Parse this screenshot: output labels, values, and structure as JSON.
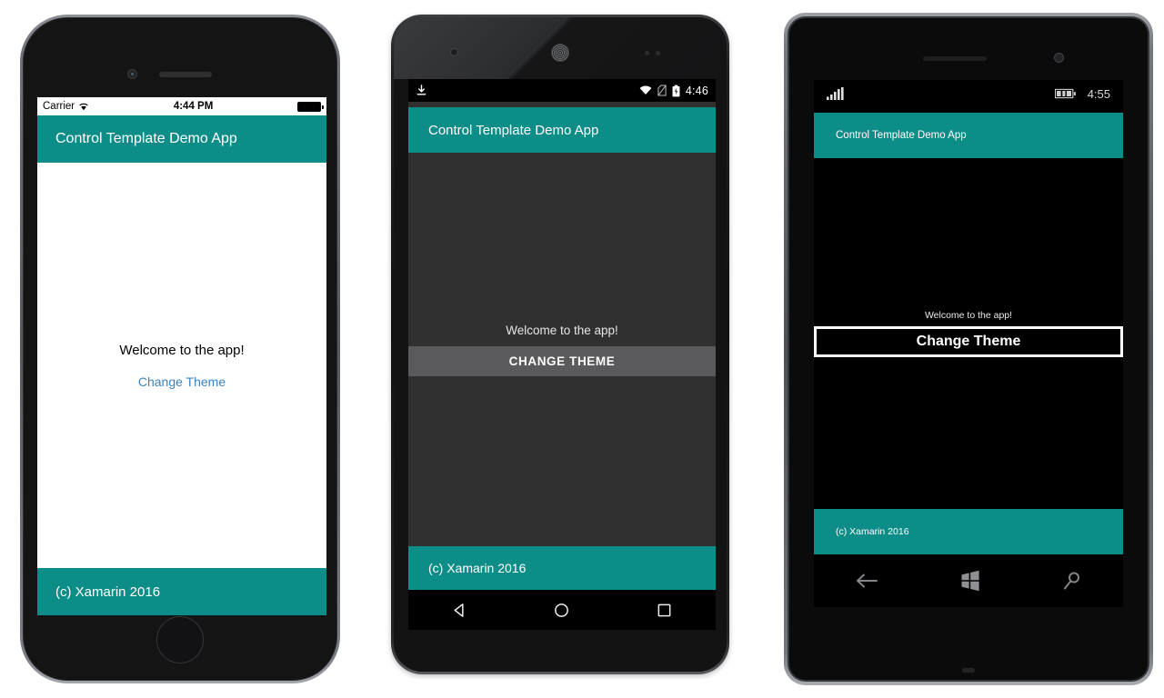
{
  "app": {
    "header_title": "Control Template Demo App",
    "welcome_text": "Welcome to the app!",
    "change_theme_label_ios": "Change Theme",
    "change_theme_label_android": "CHANGE THEME",
    "change_theme_label_windows": "Change Theme",
    "footer_text": "(c) Xamarin 2016"
  },
  "colors": {
    "accent_teal": "#0D8D88",
    "ios_link_blue": "#3B82C4",
    "android_page_bg": "#303030",
    "android_button_bg": "#5A5A5C",
    "windows_page_bg": "#000000",
    "ios_page_bg": "#FFFFFF"
  },
  "devices": [
    {
      "name": "iPhone",
      "platform": "ios",
      "status_bar": {
        "carrier": "Carrier",
        "wifi_icon": "wifi-icon",
        "time": "4:44 PM",
        "battery_icon": "battery-full-icon"
      }
    },
    {
      "name": "Android",
      "platform": "android",
      "status_bar": {
        "download_icon": "download-icon",
        "wifi_icon": "wifi-icon",
        "sim_icon": "no-sim-icon",
        "battery_icon": "battery-charging-icon",
        "time": "4:46"
      },
      "nav_bar": {
        "back": "back-triangle-icon",
        "home": "home-circle-icon",
        "recents": "recents-square-icon"
      }
    },
    {
      "name": "Windows Phone",
      "platform": "windows",
      "status_bar": {
        "signal_icon": "signal-bars-icon",
        "battery_icon": "battery-icon",
        "time": "4:55"
      },
      "nav_bar": {
        "back": "back-arrow-icon",
        "start": "windows-logo-icon",
        "search": "search-icon"
      }
    }
  ]
}
